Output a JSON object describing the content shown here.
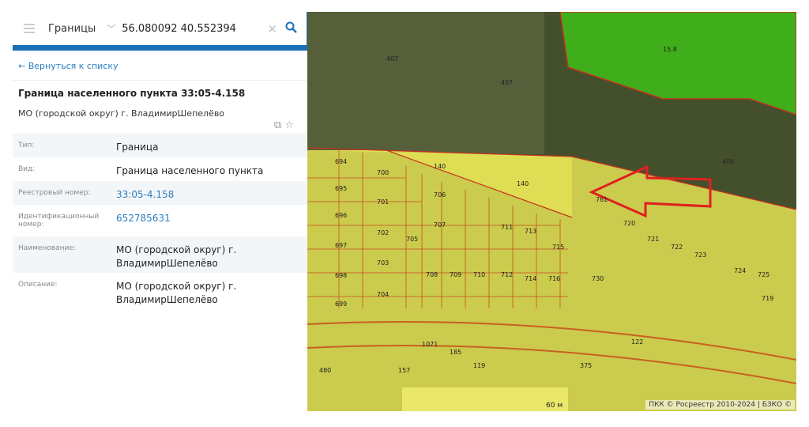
{
  "search": {
    "layer": "Границы",
    "query": "56.080092 40.552394"
  },
  "back_link": "← Вернуться к списку",
  "object": {
    "title": "Граница населенного пункта 33:05-4.158",
    "subtitle": "МО (городской округ) г. ВладимирШепелёво"
  },
  "properties": [
    {
      "label": "Тип:",
      "value": "Граница",
      "link": false
    },
    {
      "label": "Вид:",
      "value": "Граница населенного пункта",
      "link": false
    },
    {
      "label": "Реестровый номер:",
      "value": "33:05-4.158",
      "link": true
    },
    {
      "label": "Идентификационный номер:",
      "value": "652785631",
      "link": true
    },
    {
      "label": "Наименование:",
      "value": "МО (городской округ) г. ВладимирШепелёво",
      "link": false
    },
    {
      "label": "Описание:",
      "value": "МО (городской округ) г. ВладимирШепелёво",
      "link": false
    }
  ],
  "map": {
    "scale": "60 м",
    "attribution": "ПКК © Росреестр 2010-2024 | БЗКО ©",
    "green_label": "15.8",
    "parcels": [
      "407",
      "407",
      "140",
      "140",
      "406",
      "694",
      "695",
      "696",
      "697",
      "698",
      "699",
      "700",
      "701",
      "702",
      "703",
      "704",
      "706",
      "707",
      "708",
      "709",
      "710",
      "711",
      "712",
      "713",
      "714",
      "715",
      "716",
      "705",
      "730",
      "761",
      "720",
      "721",
      "722",
      "723",
      "724",
      "725",
      "719",
      "122",
      "1071",
      "185",
      "157",
      "119",
      "375",
      "480"
    ]
  },
  "colors": {
    "accent": "#1a6fb8",
    "link": "#2a7ec0"
  }
}
